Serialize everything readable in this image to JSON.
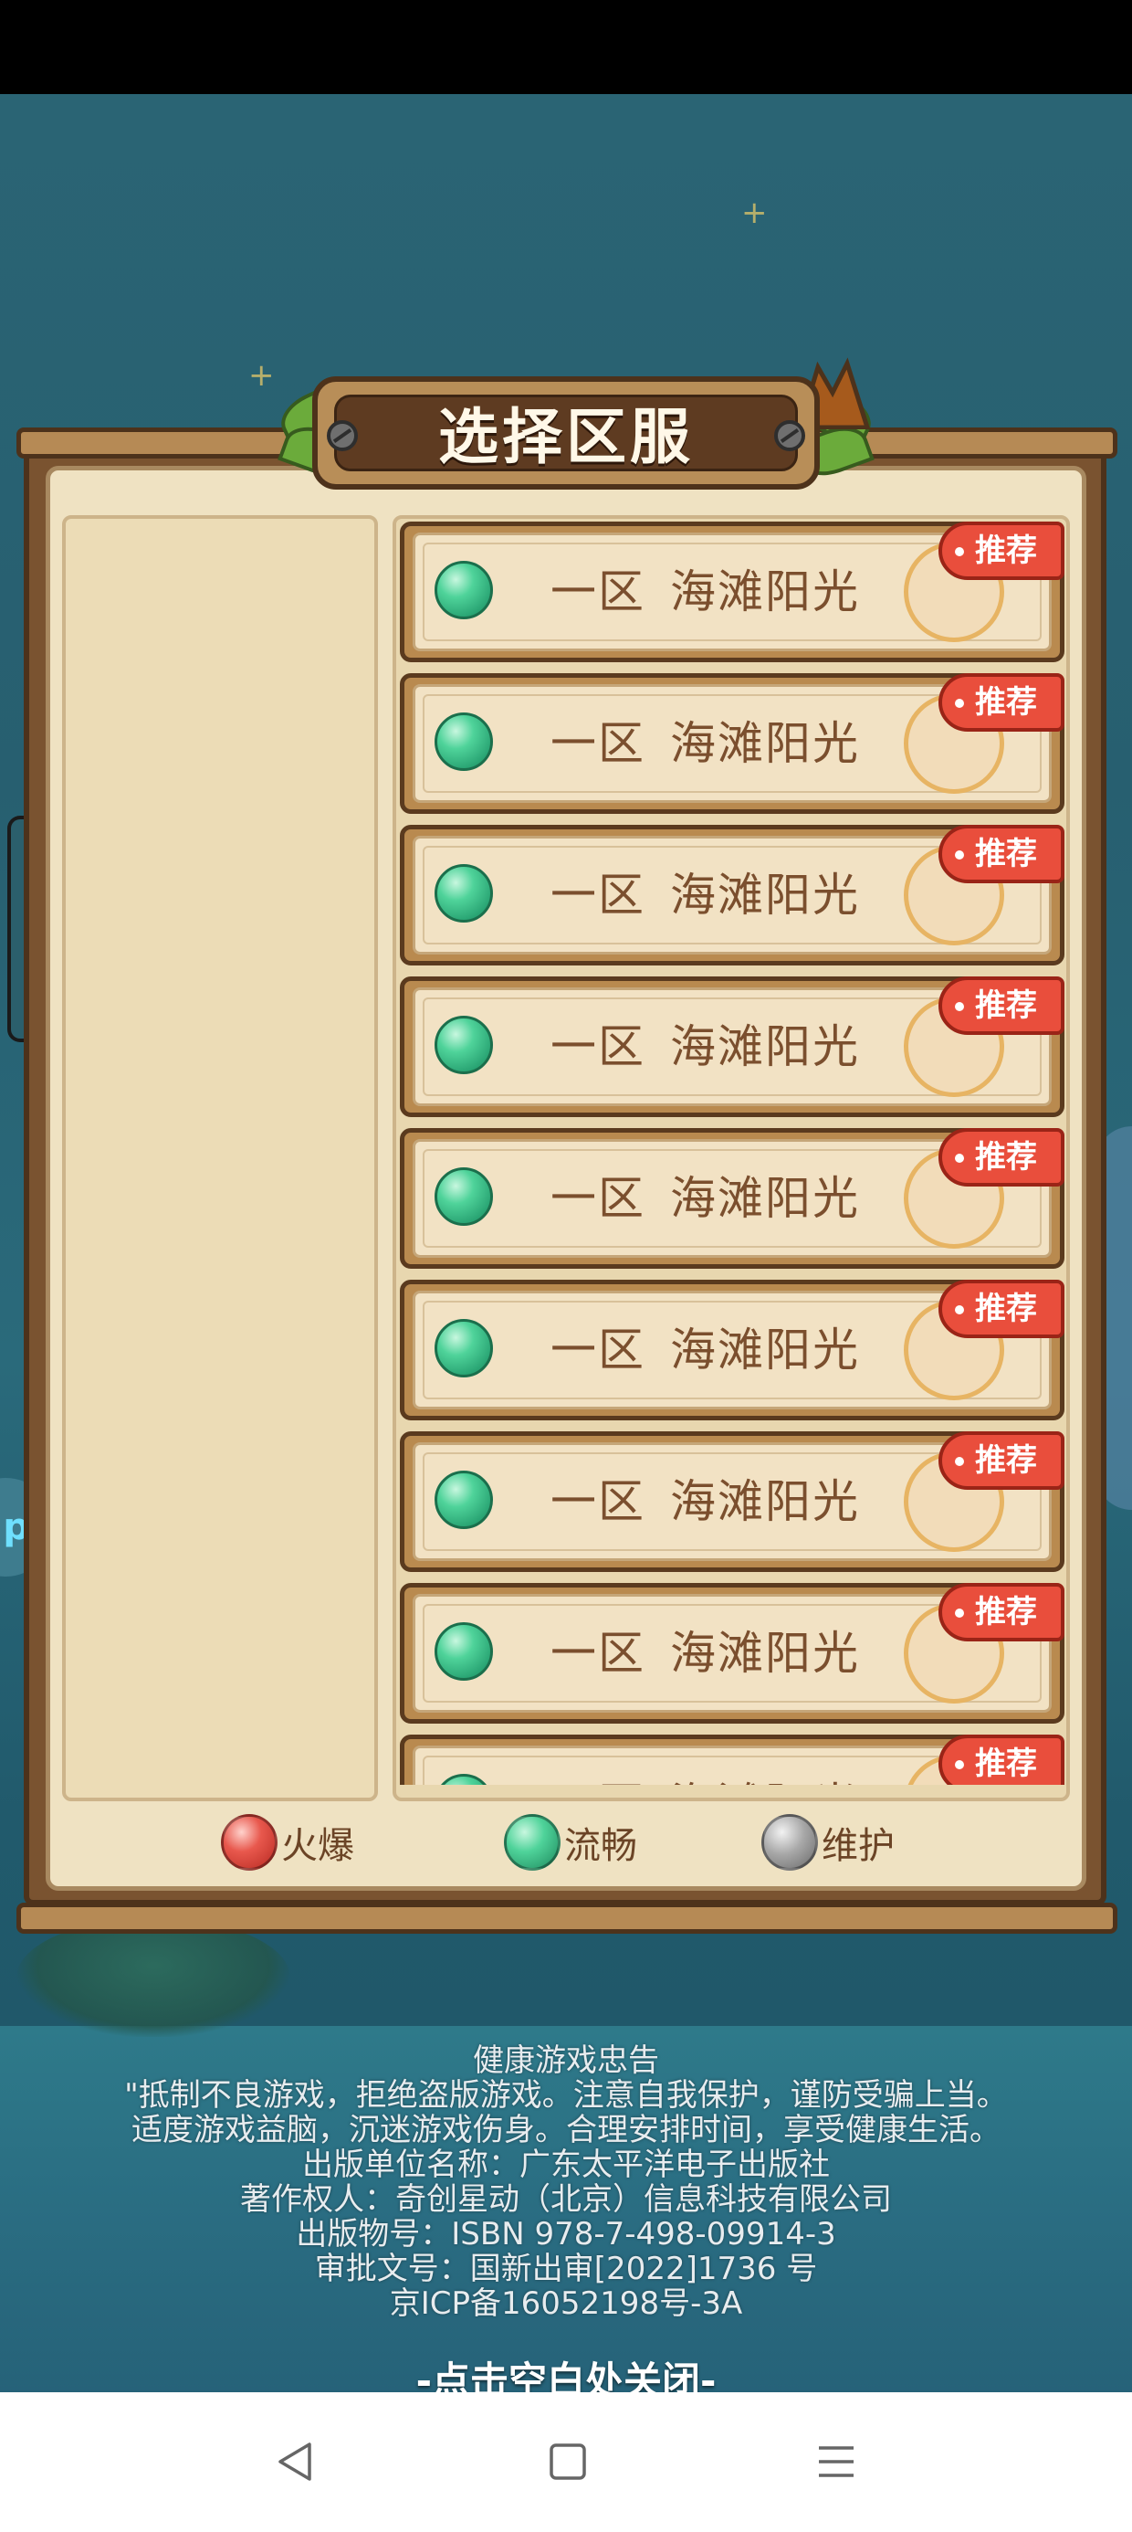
{
  "title": "选择区服",
  "servers": [
    {
      "zone": "一区",
      "name": "海滩阳光",
      "status": "流畅",
      "tag": "推荐"
    },
    {
      "zone": "一区",
      "name": "海滩阳光",
      "status": "流畅",
      "tag": "推荐"
    },
    {
      "zone": "一区",
      "name": "海滩阳光",
      "status": "流畅",
      "tag": "推荐"
    },
    {
      "zone": "一区",
      "name": "海滩阳光",
      "status": "流畅",
      "tag": "推荐"
    },
    {
      "zone": "一区",
      "name": "海滩阳光",
      "status": "流畅",
      "tag": "推荐"
    },
    {
      "zone": "一区",
      "name": "海滩阳光",
      "status": "流畅",
      "tag": "推荐"
    },
    {
      "zone": "一区",
      "name": "海滩阳光",
      "status": "流畅",
      "tag": "推荐"
    },
    {
      "zone": "一区",
      "name": "海滩阳光",
      "status": "流畅",
      "tag": "推荐"
    },
    {
      "zone": "一区",
      "name": "海滩阳光",
      "status": "流畅",
      "tag": "推荐"
    }
  ],
  "legend": [
    {
      "label": "火爆",
      "color": "#e0413a"
    },
    {
      "label": "流畅",
      "color": "#3fcf8e"
    },
    {
      "label": "维护",
      "color": "#9a9a9a"
    }
  ],
  "health_notice": {
    "title": "健康游戏忠告",
    "line1": "\"抵制不良游戏，拒绝盗版游戏。注意自我保护，谨防受骗上当。",
    "line2": "适度游戏益脑，沉迷游戏伤身。合理安排时间，享受健康生活。",
    "publisher": "出版单位名称：广东太平洋电子出版社",
    "copyright": "著作权人：奇创星动（北京）信息科技有限公司",
    "isbn": "出版物号：ISBN 978-7-498-09914-3",
    "approval": "审批文号：国新出审[2022]1736 号",
    "icp": "京ICP备16052198号-3A"
  },
  "close_hint": "-点击空白处关闭-",
  "side_bubble_text": "p",
  "colors": {
    "frame_wood": "#7a5330",
    "panel_bg": "#efe2c2",
    "tag_red": "#e94e3c",
    "status_green": "#3fcf8e"
  }
}
